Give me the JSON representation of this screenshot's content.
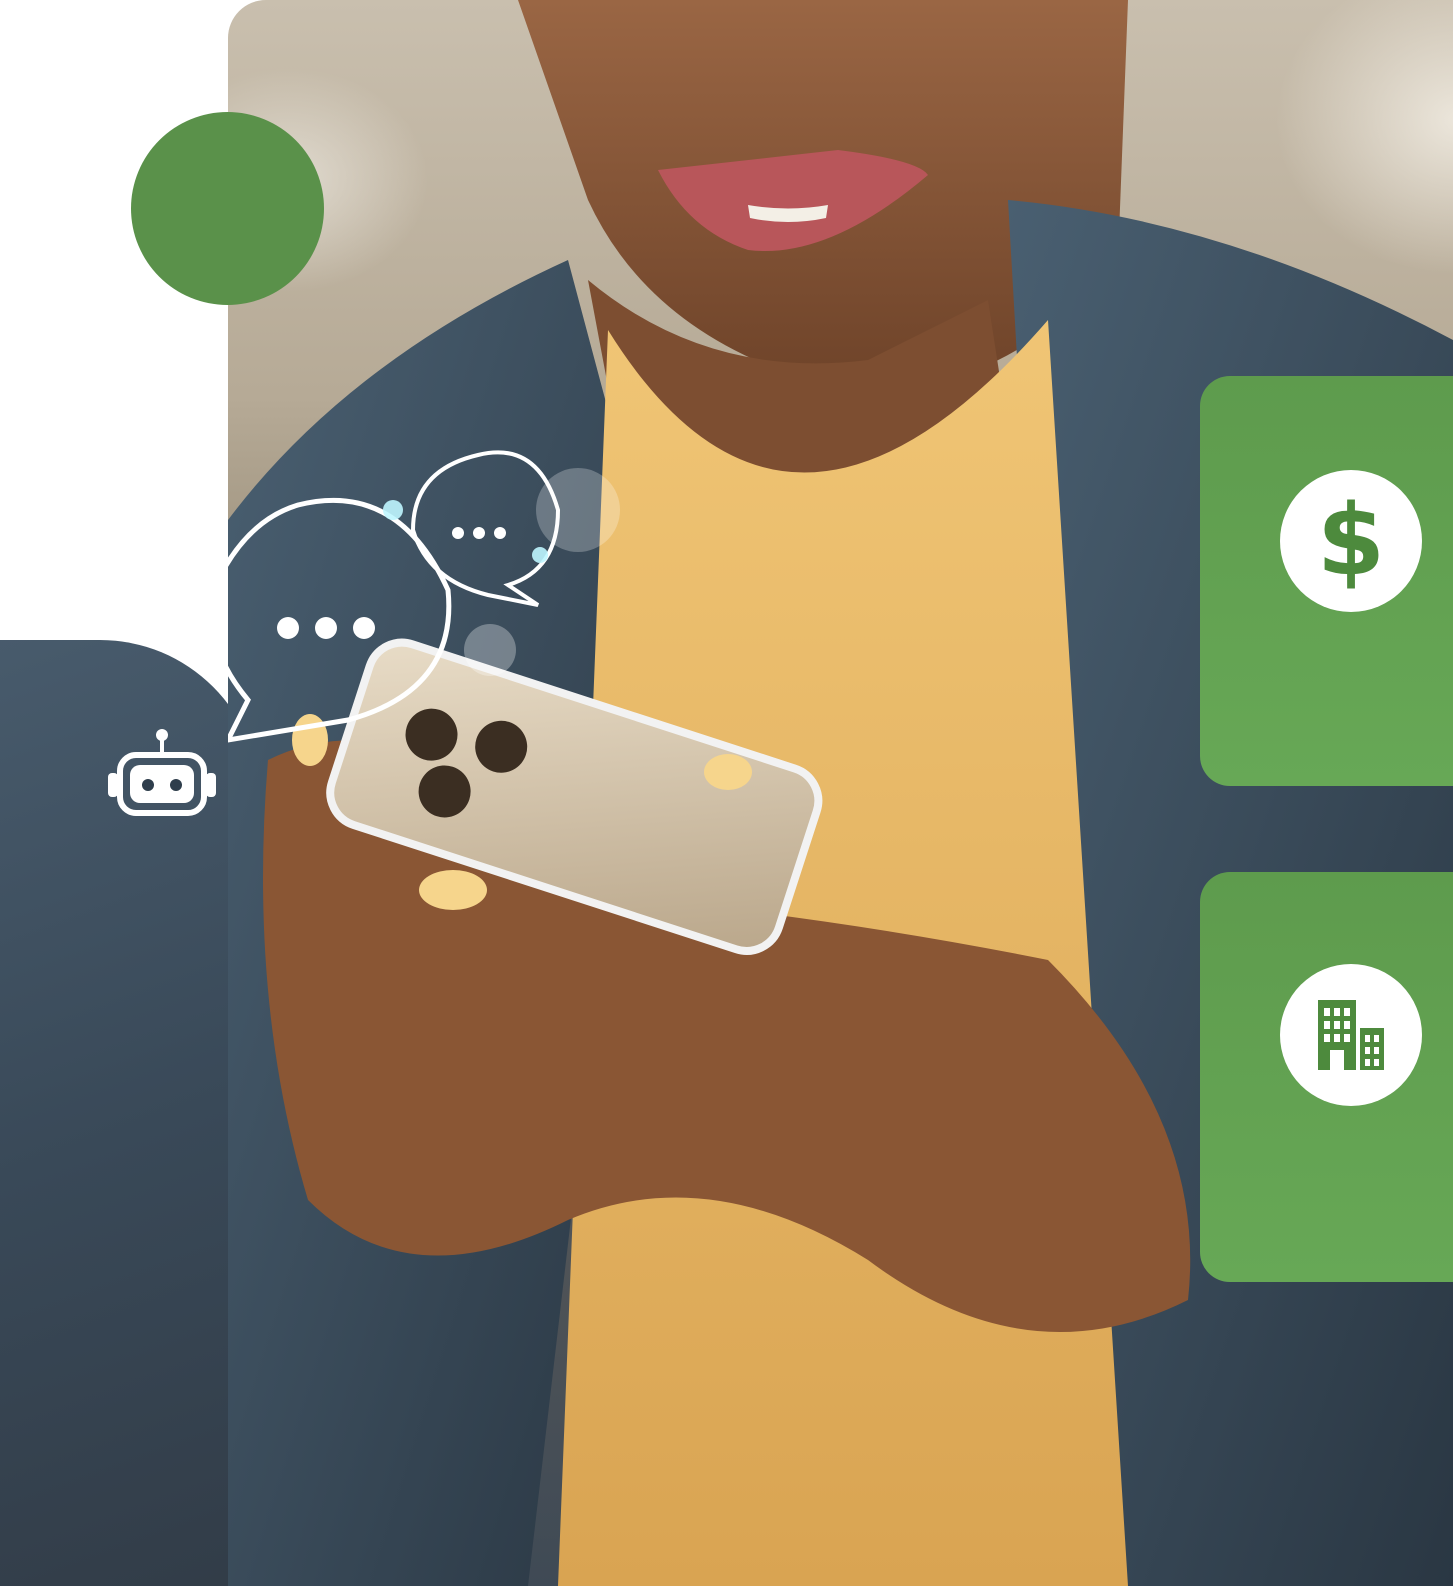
{
  "colors": {
    "accent_green": "#5a914a",
    "card_green": "#62a150",
    "icon_green": "#4d8a3d",
    "shirt_yellow": "#e8b866",
    "jacket_denim": "#3e5264",
    "skin": "#8a5a3a"
  },
  "icons": {
    "dollar": "dollar-icon",
    "building": "building-icon",
    "chat_large": "chat-bubble-icon",
    "chat_small": "chat-bubble-icon",
    "chatbot": "robot-icon"
  },
  "cards": [
    {
      "icon": "dollar-icon",
      "glyph": "$"
    },
    {
      "icon": "building-icon",
      "glyph": ""
    }
  ]
}
